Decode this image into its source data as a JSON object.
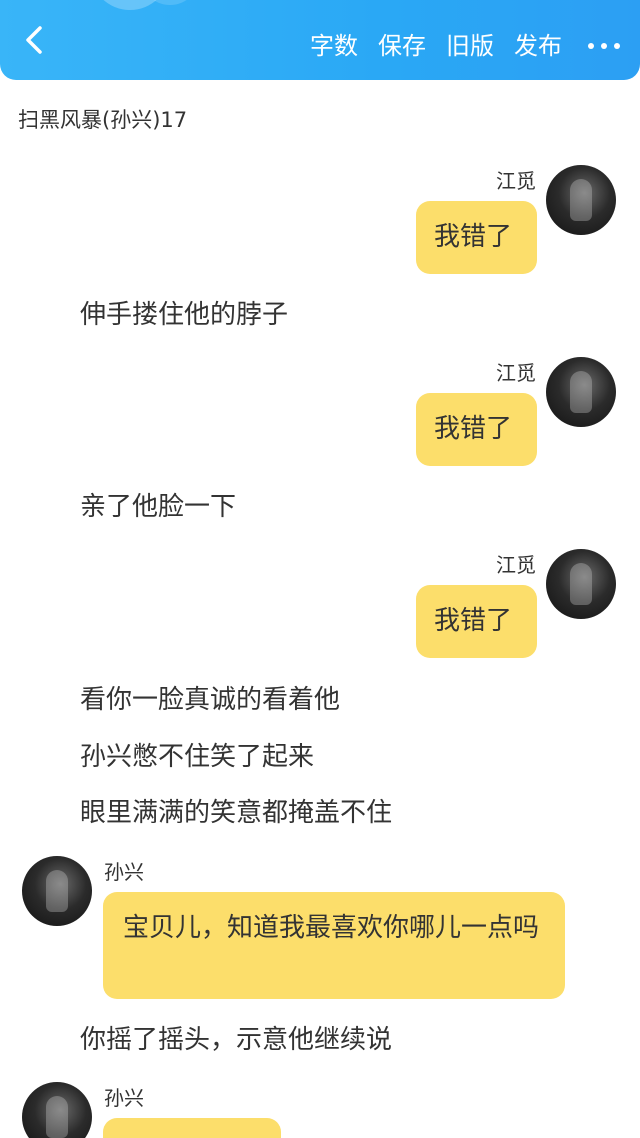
{
  "header": {
    "back_icon": "chevron-left-icon",
    "word_count_label": "字数",
    "save_label": "保存",
    "old_version_label": "旧版",
    "publish_label": "发布",
    "more_icon": "more-dots-icon"
  },
  "story": {
    "title": "扫黑风暴(孙兴)17"
  },
  "colors": {
    "header_start": "#39b5f8",
    "header_end": "#2c9ff3",
    "bubble": "#fcde6b",
    "text": "#333333"
  },
  "messages": {
    "m1": {
      "speaker": "江觅",
      "text": "我错了"
    },
    "n1": "伸手搂住他的脖子",
    "m2": {
      "speaker": "江觅",
      "text": "我错了"
    },
    "n2": "亲了他脸一下",
    "m3": {
      "speaker": "江觅",
      "text": "我错了"
    },
    "n3": "看你一脸真诚的看着他",
    "n4": "孙兴憋不住笑了起来",
    "n5": "眼里满满的笑意都掩盖不住",
    "m4": {
      "speaker": "孙兴",
      "text": "宝贝儿，知道我最喜欢你哪儿一点吗"
    },
    "n6": "你摇了摇头，示意他继续说",
    "m5": {
      "speaker": "孙兴",
      "text": ""
    }
  }
}
